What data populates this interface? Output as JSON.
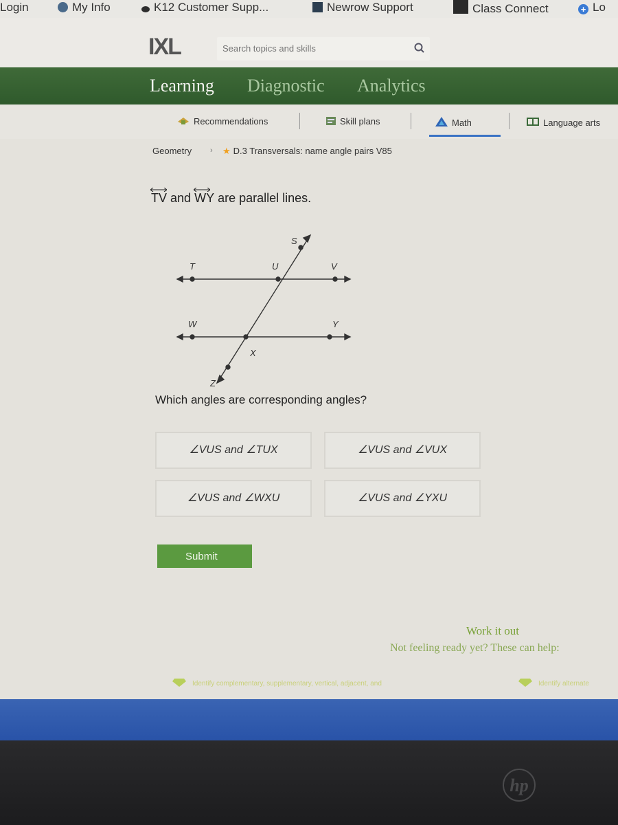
{
  "bookmarks": [
    {
      "label": "Login",
      "icon": "none"
    },
    {
      "label": "My Info",
      "icon": "site-icon"
    },
    {
      "label": "K12 Customer Supp...",
      "icon": "k12-icon"
    },
    {
      "label": "Newrow Support",
      "icon": "newrow-icon"
    },
    {
      "label": "Class Connect",
      "icon": "class-connect-icon"
    },
    {
      "label": "Lo",
      "icon": "plus-icon"
    }
  ],
  "header": {
    "logo": "IXL",
    "search_placeholder": "Search topics and skills"
  },
  "nav": {
    "tabs": [
      {
        "label": "Learning",
        "active": true
      },
      {
        "label": "Diagnostic",
        "active": false
      },
      {
        "label": "Analytics",
        "active": false
      }
    ]
  },
  "subnav": {
    "items": [
      {
        "label": "Recommendations"
      },
      {
        "label": "Skill plans"
      },
      {
        "label": "Math",
        "active": true
      },
      {
        "label": "Language arts"
      }
    ]
  },
  "breadcrumb": {
    "subject": "Geometry",
    "separator": "›",
    "skill": "D.3 Transversals: name angle pairs V85"
  },
  "question": {
    "line1": "TV",
    "and": "and",
    "line2": "WY",
    "rest": "are parallel lines.",
    "prompt": "Which angles are corresponding angles?",
    "figure_labels": {
      "S": "S",
      "T": "T",
      "U": "U",
      "V": "V",
      "W": "W",
      "X": "X",
      "Y": "Y",
      "Z": "Z"
    }
  },
  "choices": [
    "∠VUS and ∠TUX",
    "∠VUS and ∠VUX",
    "∠VUS and ∠WXU",
    "∠VUS and ∠YXU"
  ],
  "submit_label": "Submit",
  "help": {
    "title": "Work it out",
    "subtitle": "Not feeling ready yet? These can help:",
    "links": [
      "Identify complementary, supplementary, vertical, adjacent, and",
      "Identify alternate"
    ]
  },
  "device": {
    "brand": "hp"
  },
  "colors": {
    "nav_green": "#356131",
    "submit_green": "#5b9a40",
    "math_blue": "#3b73c4",
    "taskbar_blue": "#2f5aad"
  }
}
